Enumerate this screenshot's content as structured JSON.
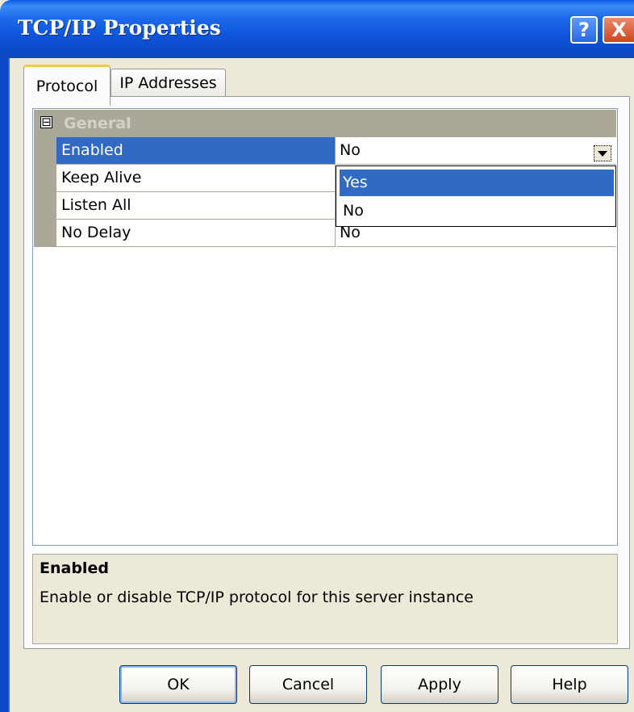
{
  "window": {
    "title": "TCP/IP Properties",
    "help_button": "?",
    "close_button": "X"
  },
  "tabs": [
    {
      "label": "Protocol",
      "active": true
    },
    {
      "label": "IP Addresses",
      "active": false
    }
  ],
  "grid": {
    "category": {
      "label": "General",
      "expanded": true,
      "toggle_glyph": "⊟"
    },
    "properties": [
      {
        "name": "Enabled",
        "value": "No",
        "selected": true
      },
      {
        "name": "Keep Alive",
        "value": ""
      },
      {
        "name": "Listen All",
        "value": ""
      },
      {
        "name": "No Delay",
        "value": "No"
      }
    ],
    "dropdown": {
      "options": [
        "Yes",
        "No"
      ],
      "highlighted": "Yes"
    }
  },
  "description": {
    "title": "Enabled",
    "text": "Enable or disable TCP/IP protocol for this server instance"
  },
  "buttons": {
    "ok": "OK",
    "cancel": "Cancel",
    "apply_mnemonic": "A",
    "apply_rest": "pply",
    "help": "Help"
  },
  "colors": {
    "titlebar": "#0A49C9",
    "selection": "#316AC5",
    "dialog_bg": "#ECE9D8",
    "active_tab_accent": "#FFC83C"
  }
}
